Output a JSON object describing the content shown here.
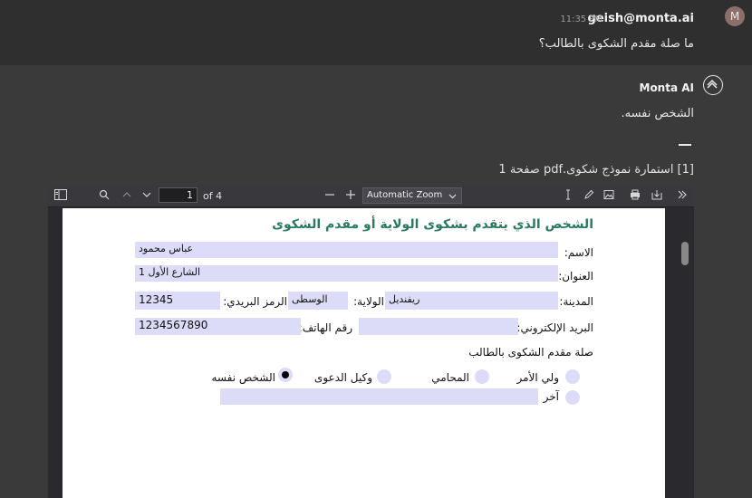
{
  "user_message": {
    "avatar_letter": "M",
    "name": "geish@monta.ai",
    "time": "11:35 PM",
    "text": "ما صلة مقدم الشكوى بالطالب؟"
  },
  "ai_message": {
    "name": "Monta AI",
    "text": "الشخص نفسه.",
    "reference": "[1] استمارة نموذج شكوى.pdf صفحة 1"
  },
  "pdf_toolbar": {
    "current_page": "1",
    "of_pages": "of 4",
    "zoom": "Automatic Zoom"
  },
  "form": {
    "title": "الشخص الذي يتقدم بشكوى الولاية أو مقدم الشكوى",
    "name_label": "الاسم:",
    "name_value": "عباس محمود",
    "address_label": "العنوان:",
    "address_value": "الشارع الأول 1",
    "city_label": "المدينة:",
    "city_value": "ريفنديل",
    "state_label": "الولاية:",
    "state_value": "الوسطى",
    "zip_label": "الرمز البريدي:",
    "zip_value": "12345",
    "email_label": "البريد الإلكتروني:",
    "email_value": "",
    "phone_label": "رقم الهاتف:",
    "phone_value": "1234567890",
    "relation_label": "صلة مقدم الشكوى بالطالب",
    "options": [
      {
        "label": "ولي الأمر",
        "checked": false
      },
      {
        "label": "المحامي",
        "checked": false
      },
      {
        "label": "وكيل الدعوى",
        "checked": false
      },
      {
        "label": "الشخص نفسه",
        "checked": true
      },
      {
        "label": "آخر",
        "checked": false
      }
    ],
    "other_value": ""
  }
}
